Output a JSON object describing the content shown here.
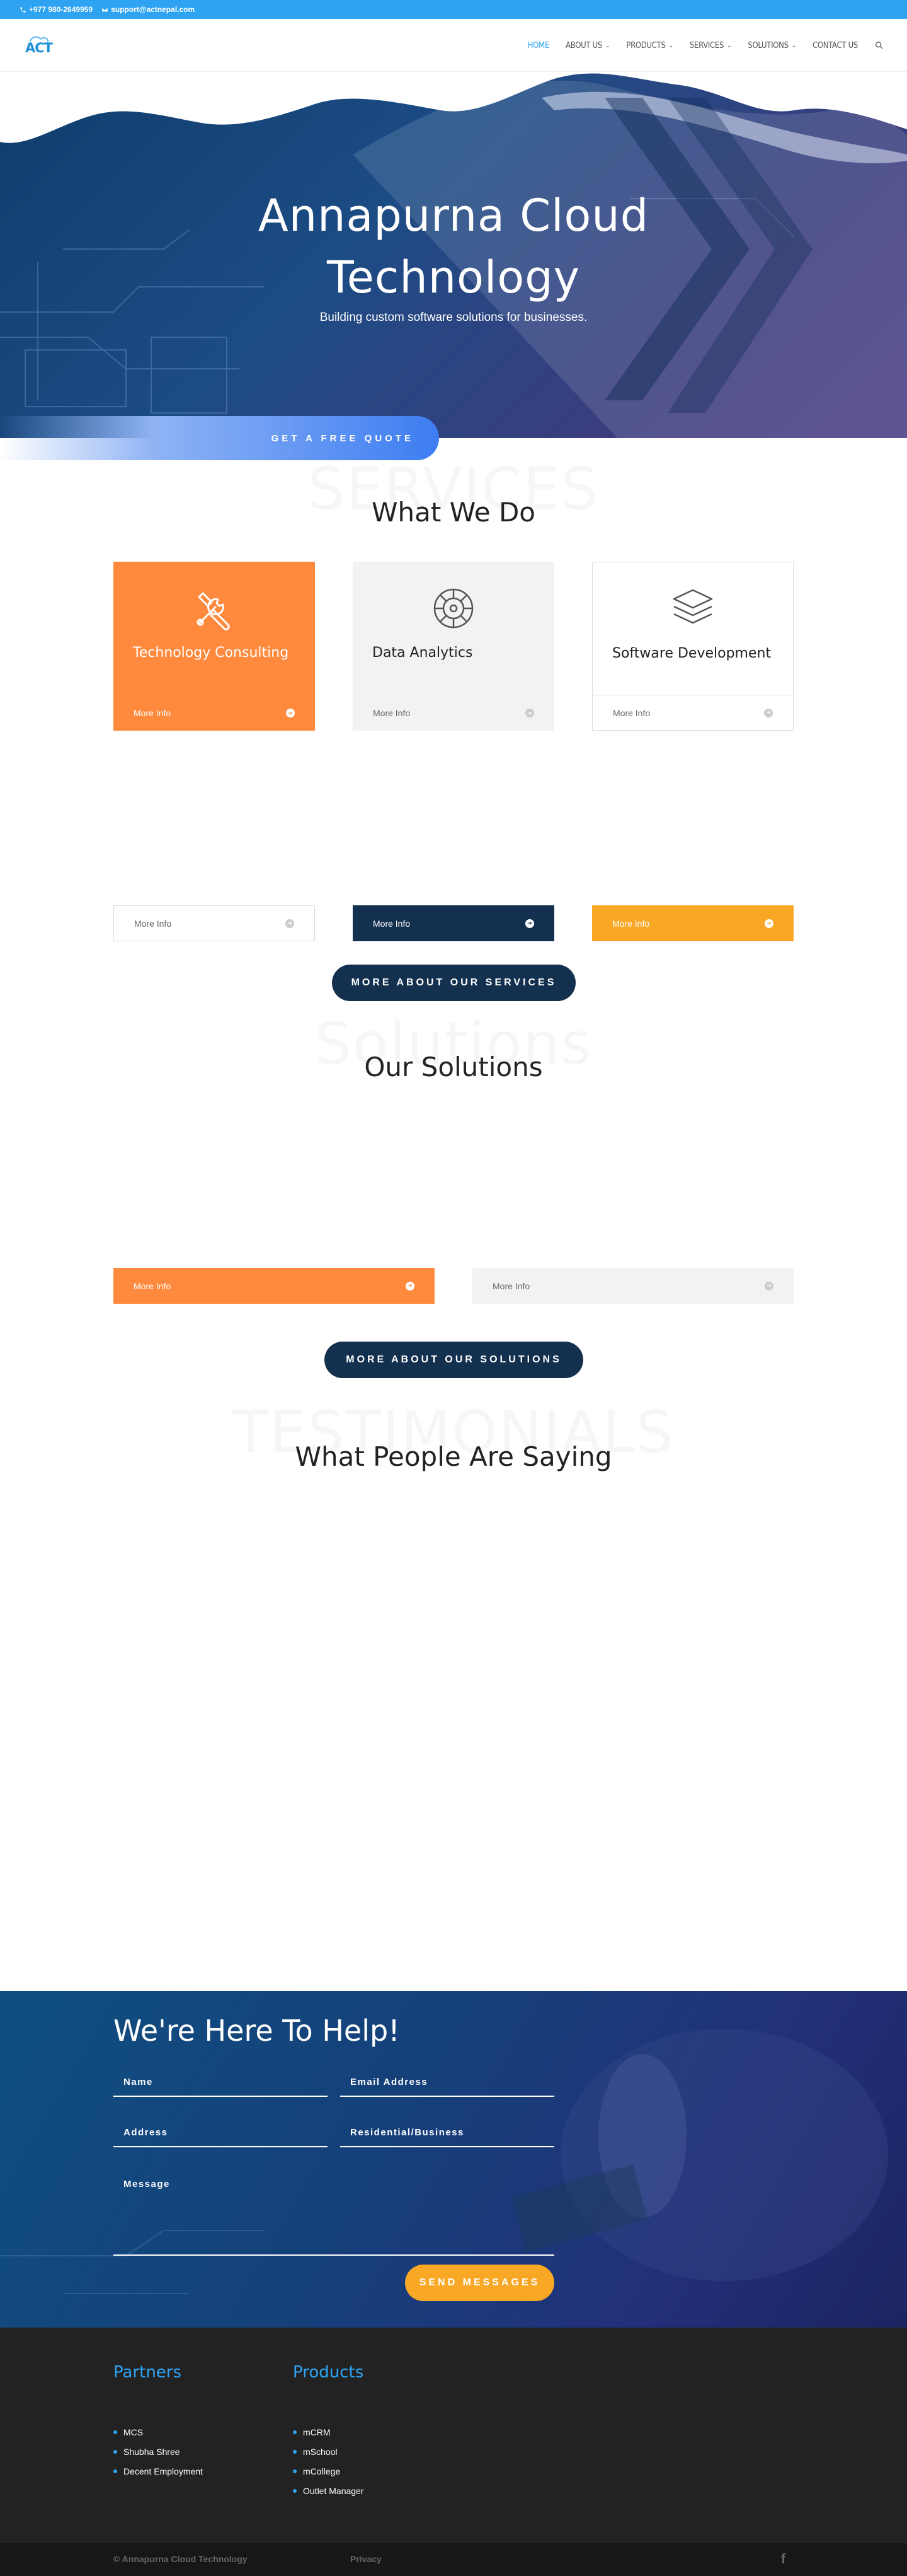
{
  "topbar": {
    "phone": "+977 980-2649959",
    "email": "support@actnepal.com"
  },
  "header": {
    "logo_text": "ACT",
    "nav": [
      {
        "label": "HOME",
        "active": true,
        "has_dropdown": false
      },
      {
        "label": "ABOUT US",
        "active": false,
        "has_dropdown": true
      },
      {
        "label": "PRODUCTS",
        "active": false,
        "has_dropdown": true
      },
      {
        "label": "SERVICES",
        "active": false,
        "has_dropdown": true
      },
      {
        "label": "SOLUTIONS",
        "active": false,
        "has_dropdown": true
      },
      {
        "label": "CONTACT US",
        "active": false,
        "has_dropdown": false
      }
    ]
  },
  "hero": {
    "title_line1": "Annapurna Cloud",
    "title_line2": "Technology",
    "subtitle": "Building custom software solutions for businesses.",
    "cta": "GET A FREE QUOTE"
  },
  "services": {
    "watermark": "SERVICES",
    "title": "What We Do",
    "cards": [
      {
        "title": "Technology Consulting",
        "more": "More Info",
        "icon": "tools-icon"
      },
      {
        "title": "Data Analytics",
        "more": "More Info",
        "icon": "analytics-icon"
      },
      {
        "title": "Software Development",
        "more": "More Info",
        "icon": "layers-icon"
      }
    ],
    "second_row": [
      {
        "more": "More Info"
      },
      {
        "more": "More Info"
      },
      {
        "more": "More Info"
      }
    ],
    "button": "MORE ABOUT OUR SERVICES"
  },
  "solutions": {
    "watermark": "Solutions",
    "title": "Our Solutions",
    "items": [
      {
        "more": "More Info"
      },
      {
        "more": "More Info"
      }
    ],
    "button": "MORE ABOUT OUR SOLUTIONS"
  },
  "testimonials": {
    "watermark": "TESTIMONIALS",
    "title": "What People Are Saying"
  },
  "contact": {
    "title": "We're Here To Help!",
    "name_placeholder": "Name",
    "email_placeholder": "Email Address",
    "address_placeholder": "Address",
    "type_placeholder": "Residential/Business",
    "message_placeholder": "Message",
    "send": "SEND MESSAGES"
  },
  "footer": {
    "partners_title": "Partners",
    "partners": [
      "MCS",
      "Shubha Shree",
      "Decent Employment"
    ],
    "products_title": "Products",
    "products": [
      "mCRM",
      "mSchool",
      "mCollege",
      "Outlet Manager"
    ],
    "copyright": "© Annapurna Cloud Technology",
    "privacy": "Privacy",
    "social": "f"
  },
  "colors": {
    "accent": "#2ea3f2",
    "orange": "#ff8a3d",
    "amber": "#f9a826",
    "navy": "#14304f",
    "light_gray": "#f2f2f2"
  }
}
